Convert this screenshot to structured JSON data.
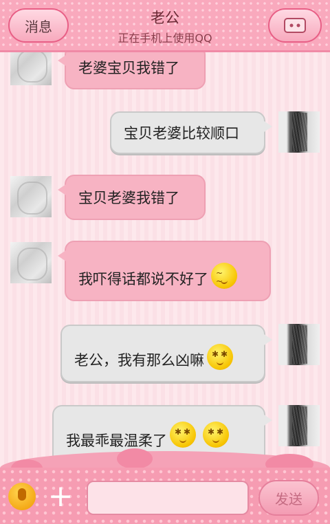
{
  "header": {
    "back_label": "消息",
    "title": "老公",
    "subtitle": "正在手机上使用QQ"
  },
  "messages": [
    {
      "side": "left",
      "text": "老婆宝贝我错了",
      "emoji_count": 0
    },
    {
      "side": "right",
      "text": "宝贝老婆比较顺口",
      "emoji_count": 0
    },
    {
      "side": "left",
      "text": "宝贝老婆我错了",
      "emoji_count": 0
    },
    {
      "side": "left",
      "text": "我吓得话都说不好了",
      "emoji_count": 1
    },
    {
      "side": "right",
      "text": "老公，我有那么凶嘛",
      "emoji_count": 1
    },
    {
      "side": "right",
      "text": "我最乖最温柔了",
      "emoji_count": 2
    }
  ],
  "input": {
    "value": ""
  },
  "footer": {
    "send_label": "发送"
  },
  "icons": {
    "profile": "profile-card-icon",
    "mic": "microphone-icon",
    "plus": "plus-icon"
  },
  "colors": {
    "header": "#f9a9bd",
    "left_bubble": "#f7b3c3",
    "right_bubble": "#e7e7e7",
    "background": "#fde8ec"
  }
}
